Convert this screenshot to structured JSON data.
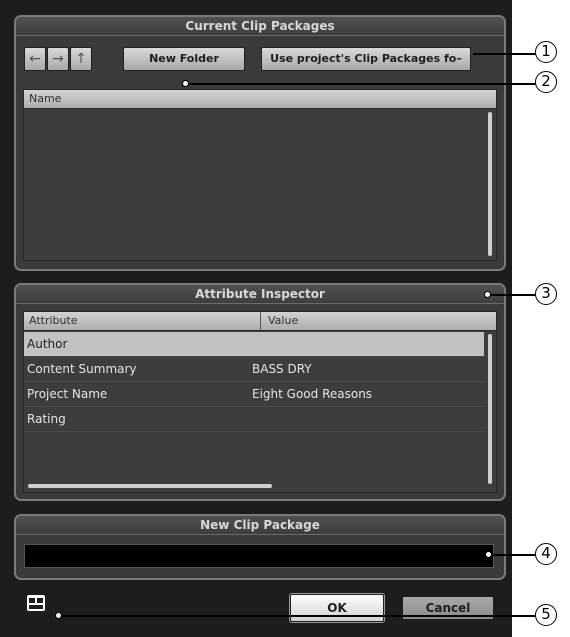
{
  "clip_packages": {
    "title": "Current Clip Packages",
    "back_arrow": "←",
    "forward_arrow": "→",
    "up_arrow": "↑",
    "new_folder_label": "New Folder",
    "use_project_label": "Use project's Clip Packages fo–",
    "name_column": "Name"
  },
  "attribute_inspector": {
    "title": "Attribute Inspector",
    "attribute_column": "Attribute",
    "value_column": "Value",
    "rows": [
      {
        "attribute": "Author",
        "value": ""
      },
      {
        "attribute": "Content Summary",
        "value": "BASS DRY"
      },
      {
        "attribute": "Project Name",
        "value": "Eight Good Reasons"
      },
      {
        "attribute": "Rating",
        "value": ""
      }
    ]
  },
  "new_clip_package": {
    "title": "New Clip Package",
    "name_value": ""
  },
  "footer": {
    "ok_label": "OK",
    "cancel_label": "Cancel",
    "layout_icon": "layout-icon"
  },
  "callouts": [
    "1",
    "2",
    "3",
    "4",
    "5"
  ]
}
